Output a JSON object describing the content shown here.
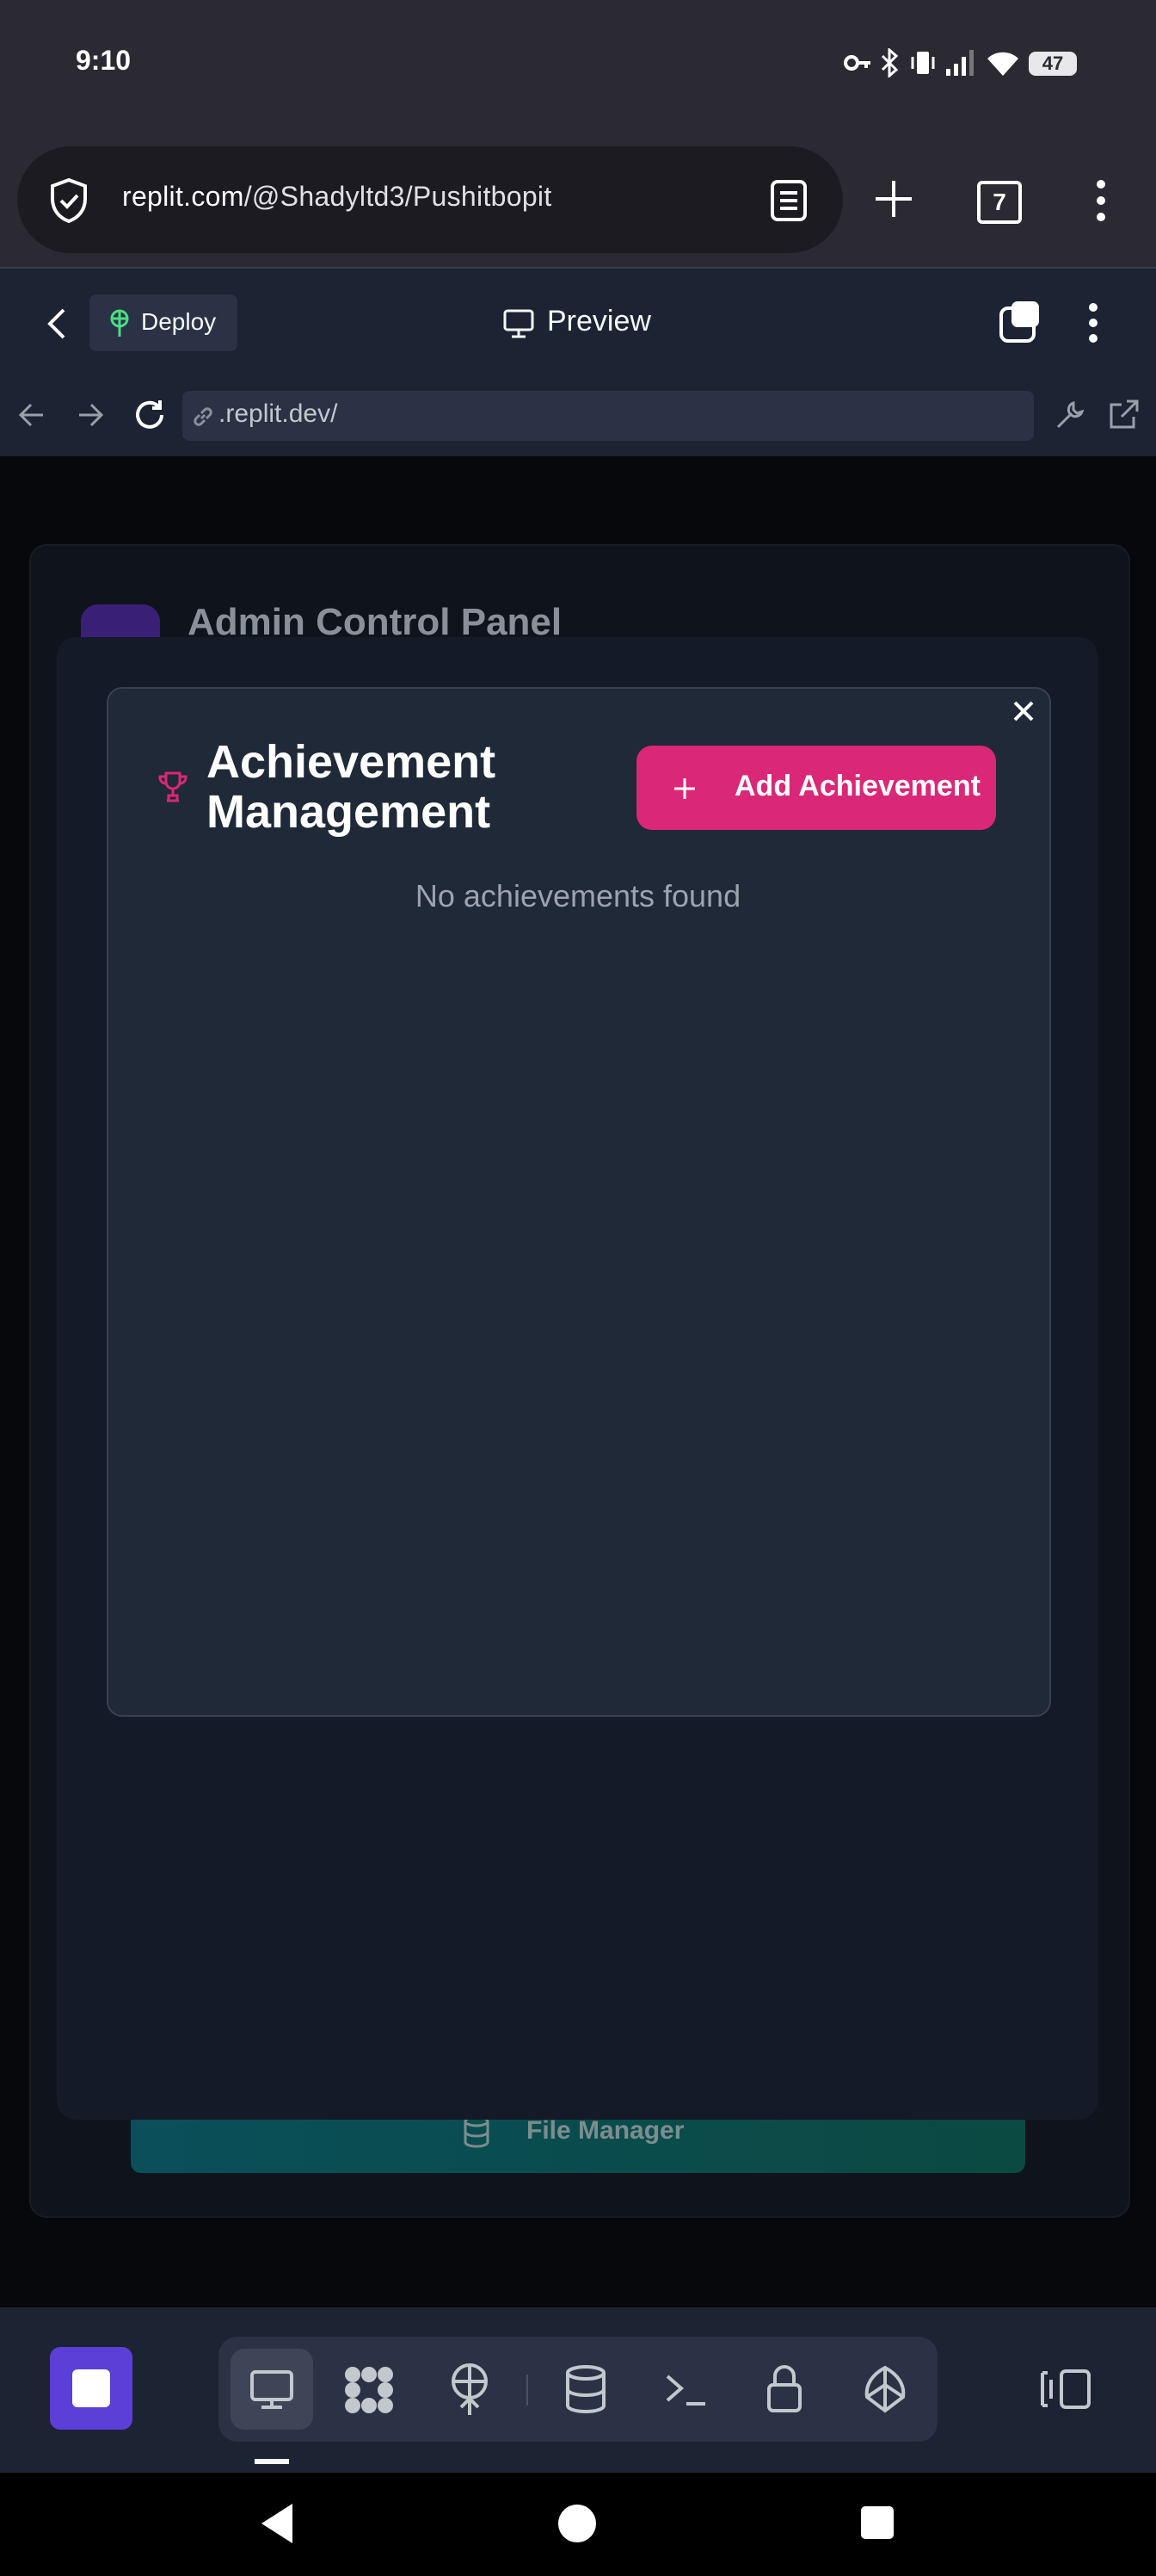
{
  "status_bar": {
    "time": "9:10",
    "battery": "47"
  },
  "browser": {
    "url_prefix": "replit.com",
    "url_path": "/@Shadyltd3/Pushitbopit",
    "tab_count": "7"
  },
  "replit_header": {
    "deploy_label": "Deploy",
    "preview_label": "Preview"
  },
  "webview": {
    "url": ".replit.dev/"
  },
  "background_page": {
    "title": "Admin Control Panel",
    "file_manager_label": "File Manager"
  },
  "modal": {
    "title": "Achievement Management",
    "add_button_label": "Add Achievement",
    "empty_message": "No achievements found"
  },
  "tools": [
    "preview-icon",
    "apps-icon",
    "deploy-icon",
    "database-icon",
    "shell-icon",
    "secrets-icon",
    "assistant-icon"
  ],
  "colors": {
    "accent_pink": "#db2777",
    "run_purple": "#5b3fd6"
  }
}
